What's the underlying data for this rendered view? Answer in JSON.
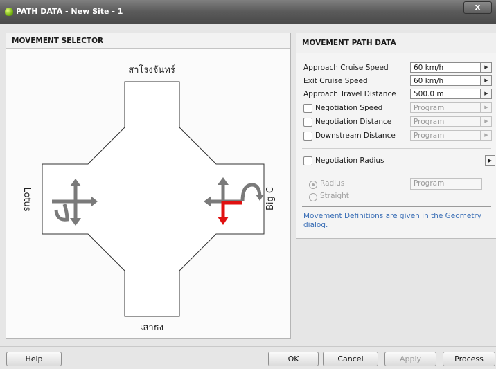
{
  "window": {
    "title": "PATH DATA - New Site - 1",
    "close_label": "x"
  },
  "movement_selector": {
    "header": "MOVEMENT SELECTOR",
    "roads": {
      "north": "สาโรงจันทร์",
      "south": "เสาธง",
      "west": "Lotus",
      "east": "Big C"
    },
    "colors": {
      "arrow": "#7a7a7a",
      "selected_arrow": "#e01010"
    }
  },
  "path_data": {
    "header": "MOVEMENT PATH DATA",
    "rows": [
      {
        "label": "Approach Cruise Speed",
        "value": "60 km/h",
        "checkbox": false,
        "enabled": true
      },
      {
        "label": "Exit Cruise Speed",
        "value": "60 km/h",
        "checkbox": false,
        "enabled": true
      },
      {
        "label": "Approach Travel Distance",
        "value": "500.0 m",
        "checkbox": false,
        "enabled": true
      },
      {
        "label": "Negotiation Speed",
        "value": "Program",
        "checkbox": true,
        "enabled": false
      },
      {
        "label": "Negotiation Distance",
        "value": "Program",
        "checkbox": true,
        "enabled": false
      },
      {
        "label": "Downstream Distance",
        "value": "Program",
        "checkbox": true,
        "enabled": false
      }
    ],
    "negotiation_radius": {
      "label": "Negotiation Radius",
      "checked": false
    },
    "radius_option": {
      "label": "Radius",
      "value": "Program",
      "selected": true
    },
    "straight_option": {
      "label": "Straight",
      "selected": false
    },
    "note": "Movement Definitions are given in the Geometry dialog."
  },
  "buttons": {
    "help": "Help",
    "ok": "OK",
    "cancel": "Cancel",
    "apply": "Apply",
    "process": "Process"
  }
}
